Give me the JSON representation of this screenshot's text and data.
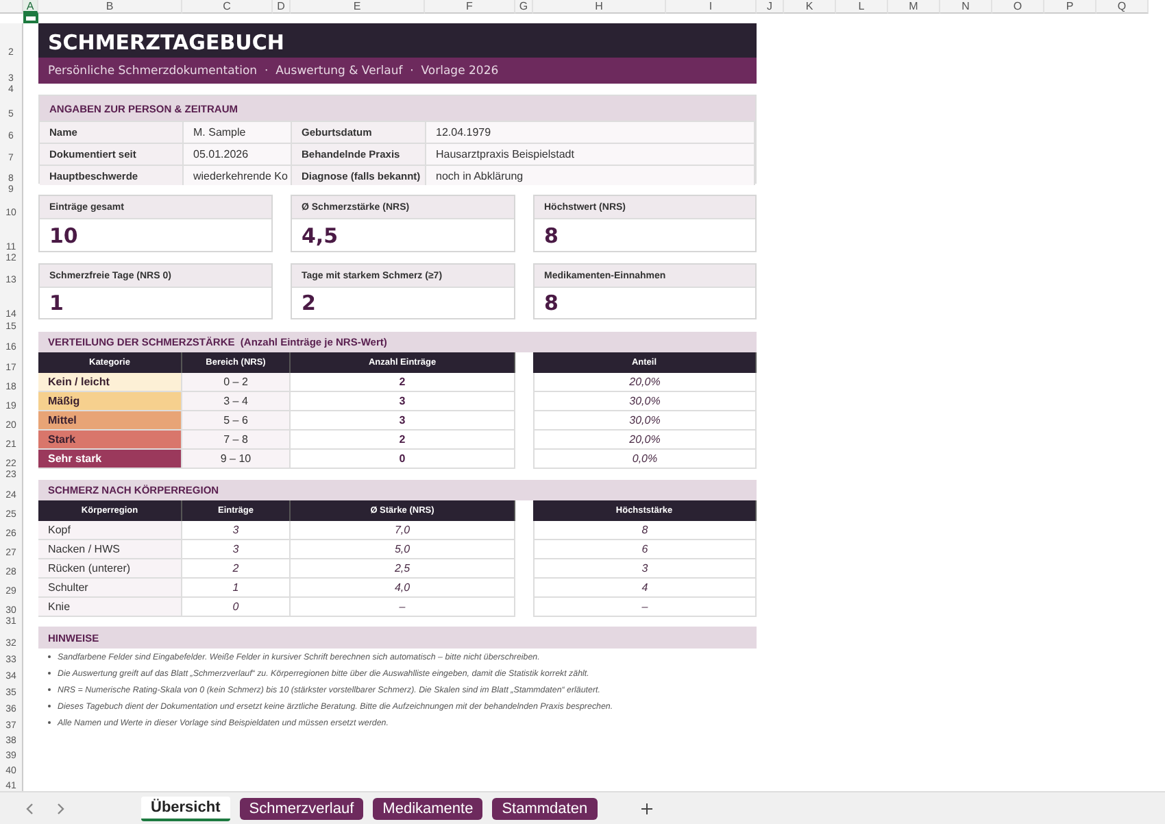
{
  "column_headers": [
    "A",
    "B",
    "C",
    "D",
    "E",
    "F",
    "G",
    "H",
    "I",
    "J",
    "K",
    "L",
    "M",
    "N",
    "O",
    "P",
    "Q"
  ],
  "row_numbers": [
    "2",
    "3",
    "4",
    "5",
    "6",
    "7",
    "8",
    "9",
    "10",
    "11",
    "12",
    "13",
    "14",
    "15",
    "16",
    "17",
    "18",
    "19",
    "20",
    "21",
    "22",
    "23",
    "24",
    "25",
    "26",
    "27",
    "28",
    "29",
    "30",
    "31",
    "32",
    "33",
    "34",
    "35",
    "36",
    "37",
    "38",
    "39",
    "40",
    "41"
  ],
  "title": "SCHMERZTAGEBUCH",
  "subtitle": "Persönliche Schmerzdokumentation  ·  Auswertung & Verlauf  ·  Vorlage 2026",
  "person": {
    "heading": "ANGABEN ZUR PERSON & ZEITRAUM",
    "rows": [
      {
        "label": "Name",
        "value": "M. Sample",
        "label_2": "Geburtsdatum",
        "value_2": "12.04.1979"
      },
      {
        "label": "Dokumentiert seit",
        "value": "05.01.2026",
        "label_2": "Behandelnde Praxis",
        "value_2": "Hausarztpraxis Beispielstadt"
      },
      {
        "label": "Hauptbeschwerde",
        "value": "wiederkehrende Ko",
        "label_2": "Diagnose (falls bekannt)",
        "value_2": "noch in Abklärung"
      }
    ]
  },
  "kpis": [
    {
      "label": "Einträge gesamt",
      "value": "10"
    },
    {
      "label": "Ø Schmerzstärke (NRS)",
      "value": "4,5"
    },
    {
      "label": "Höchstwert (NRS)",
      "value": "8"
    },
    {
      "label": "Schmerzfreie Tage (NRS 0)",
      "value": "1"
    },
    {
      "label": "Tage mit starkem Schmerz (≥7)",
      "value": "2"
    },
    {
      "label": "Medikamenten-Einnahmen",
      "value": "8"
    }
  ],
  "distribution": {
    "heading": "VERTEILUNG DER SCHMERZSTÄRKE  (Anzahl Einträge je NRS-Wert)",
    "columns": [
      "Kategorie",
      "Bereich (NRS)",
      "Anzahl Einträge",
      "Anteil"
    ],
    "rows": [
      {
        "category": "Kein / leicht",
        "color": "#fdf0d6",
        "range": "0 – 2",
        "count": "2",
        "share": "20,0%"
      },
      {
        "category": "Mäßig",
        "color": "#f6d08e",
        "range": "3 – 4",
        "count": "3",
        "share": "30,0%"
      },
      {
        "category": "Mittel",
        "color": "#e8a476",
        "range": "5 – 6",
        "count": "3",
        "share": "30,0%"
      },
      {
        "category": "Stark",
        "color": "#d9766b",
        "range": "7 – 8",
        "count": "2",
        "share": "20,0%"
      },
      {
        "category": "Sehr stark",
        "color": "#9b395c",
        "range": "9 – 10",
        "count": "0",
        "share": "0,0%"
      }
    ]
  },
  "body_regions": {
    "heading": "SCHMERZ NACH KÖRPERREGION",
    "columns": [
      "Körperregion",
      "Einträge",
      "Ø Stärke (NRS)",
      "Höchststärke"
    ],
    "rows": [
      {
        "region": "Kopf",
        "entries": "3",
        "average": "7,0",
        "max": "8"
      },
      {
        "region": "Nacken / HWS",
        "entries": "3",
        "average": "5,0",
        "max": "6"
      },
      {
        "region": "Rücken (unterer)",
        "entries": "2",
        "average": "2,5",
        "max": "3"
      },
      {
        "region": "Schulter",
        "entries": "1",
        "average": "4,0",
        "max": "4"
      },
      {
        "region": "Knie",
        "entries": "0",
        "average": "–",
        "max": "–"
      }
    ]
  },
  "notes": {
    "heading": "HINWEISE",
    "items": [
      "Sandfarbene Felder sind Eingabefelder. Weiße Felder in kursiver Schrift berechnen sich automatisch – bitte nicht überschreiben.",
      "Die Auswertung greift auf das Blatt „Schmerzverlauf“ zu. Körperregionen bitte über die Auswahlliste eingeben, damit die Statistik korrekt zählt.",
      "NRS = Numerische Rating-Skala von 0 (kein Schmerz) bis 10 (stärkster vorstellbarer Schmerz). Die Skalen sind im Blatt „Stammdaten“ erläutert.",
      "Dieses Tagebuch dient der Dokumentation und ersetzt keine ärztliche Beratung. Bitte die Aufzeichnungen mit der behandelnden Praxis besprechen.",
      "Alle Namen und Werte in dieser Vorlage sind Beispieldaten und müssen ersetzt werden."
    ]
  },
  "sheet_tabs": [
    {
      "label": "Übersicht",
      "selected": true
    },
    {
      "label": "Schmerzverlauf",
      "selected": false
    },
    {
      "label": "Medikamente",
      "selected": false
    },
    {
      "label": "Stammdaten",
      "selected": false
    }
  ]
}
